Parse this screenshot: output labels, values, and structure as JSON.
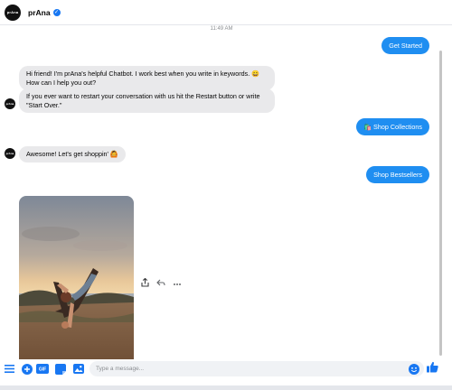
{
  "header": {
    "logo_text": "prAna",
    "name": "prAna"
  },
  "timestamp": "11:49 AM",
  "messages": {
    "get_started": "Get Started",
    "greeting": "Hi friend! I'm prAna's helpful Chatbot. I work best when you write in keywords. 😄 How can I help you out?",
    "restart_info": "If you ever want to restart your conversation with us hit the Restart button or write \"Start Over.\"",
    "shop_collections": "🛍️ Shop Collections",
    "awesome": "Awesome! Let's get shoppin' 🙆",
    "shop_bestsellers": "Shop Bestsellers"
  },
  "avatar_text": "prAna",
  "composer": {
    "placeholder": "Type a message...",
    "gif_label": "GIF"
  },
  "colors": {
    "accent": "#1f8ef1",
    "bubble_in": "#e9e9eb",
    "messenger_blue": "#1877f2"
  },
  "icons": [
    "menu-icon",
    "plus-icon",
    "gif-icon",
    "sticker-icon",
    "image-icon",
    "emoji-icon",
    "thumbs-up-icon",
    "share-icon",
    "reply-icon",
    "more-icon",
    "verified-icon"
  ]
}
